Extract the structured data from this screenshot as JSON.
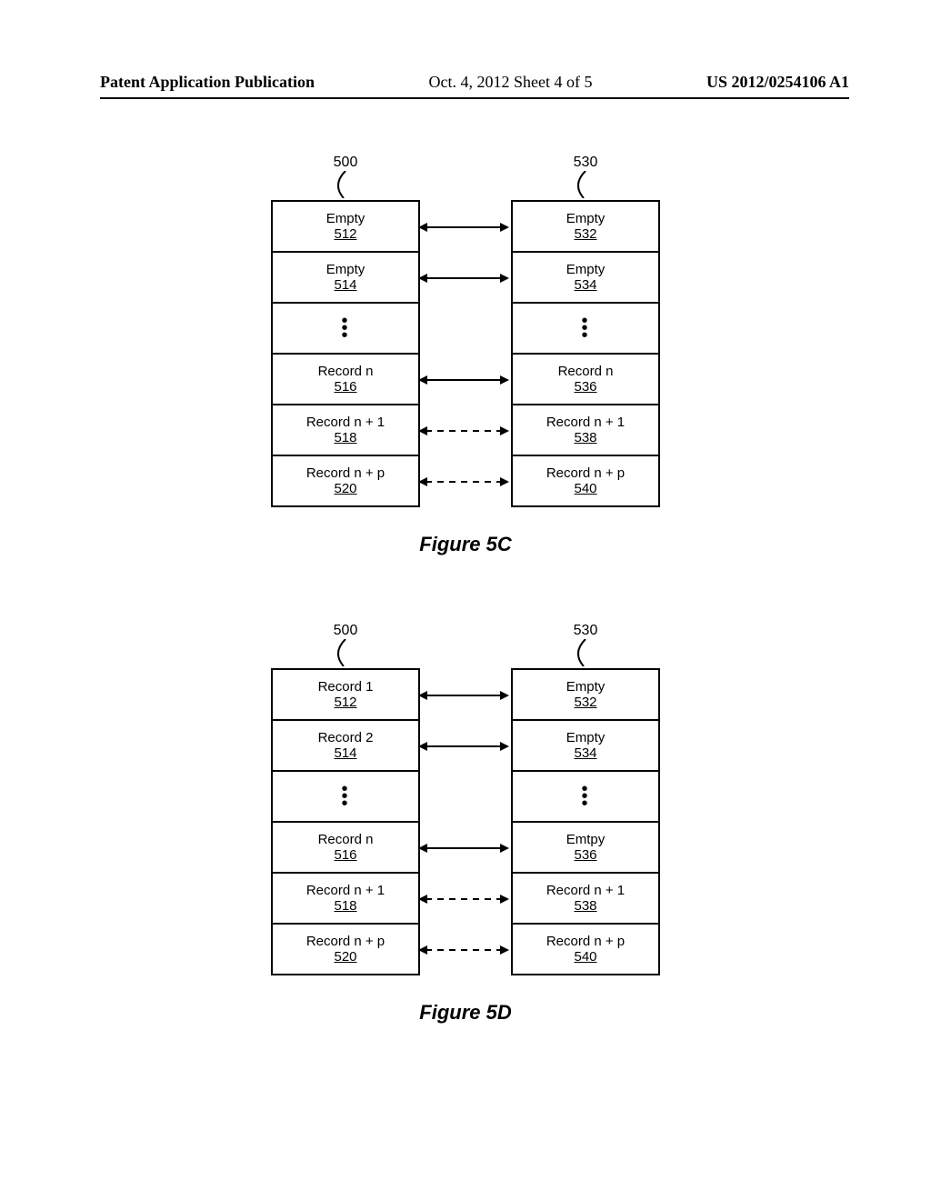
{
  "header": {
    "left": "Patent Application Publication",
    "mid": "Oct. 4, 2012  Sheet 4 of 5",
    "right": "US 2012/0254106 A1"
  },
  "fig5c": {
    "label": "Figure 5C",
    "left_ref": "500",
    "right_ref": "530",
    "left": [
      {
        "t": "Empty",
        "r": "512"
      },
      {
        "t": "Empty",
        "r": "514"
      },
      {
        "dots": true
      },
      {
        "t": "Record n",
        "r": "516"
      },
      {
        "t": "Record n + 1",
        "r": "518"
      },
      {
        "t": "Record n + p",
        "r": "520"
      }
    ],
    "right": [
      {
        "t": "Empty",
        "r": "532"
      },
      {
        "t": "Empty",
        "r": "534"
      },
      {
        "dots": true
      },
      {
        "t": "Record n",
        "r": "536"
      },
      {
        "t": "Record n + 1",
        "r": "538"
      },
      {
        "t": "Record n + p",
        "r": "540"
      }
    ],
    "rowlinks": [
      {
        "i": 0,
        "style": "solid"
      },
      {
        "i": 1,
        "style": "solid"
      },
      {
        "i": 3,
        "style": "solid"
      },
      {
        "i": 4,
        "style": "dashed"
      },
      {
        "i": 5,
        "style": "dashed"
      }
    ]
  },
  "fig5d": {
    "label": "Figure 5D",
    "left_ref": "500",
    "right_ref": "530",
    "left": [
      {
        "t": "Record 1",
        "r": "512"
      },
      {
        "t": "Record 2",
        "r": "514"
      },
      {
        "dots": true
      },
      {
        "t": "Record n",
        "r": "516"
      },
      {
        "t": "Record n + 1",
        "r": "518"
      },
      {
        "t": "Record n + p",
        "r": "520"
      }
    ],
    "right": [
      {
        "t": "Empty",
        "r": "532"
      },
      {
        "t": "Empty",
        "r": "534"
      },
      {
        "dots": true
      },
      {
        "t": "Emtpy",
        "r": "536"
      },
      {
        "t": "Record n + 1",
        "r": "538"
      },
      {
        "t": "Record n + p",
        "r": "540"
      }
    ],
    "rowlinks": [
      {
        "i": 0,
        "style": "solid"
      },
      {
        "i": 1,
        "style": "solid"
      },
      {
        "i": 3,
        "style": "solid"
      },
      {
        "i": 4,
        "style": "dashed"
      },
      {
        "i": 5,
        "style": "dashed"
      }
    ]
  }
}
